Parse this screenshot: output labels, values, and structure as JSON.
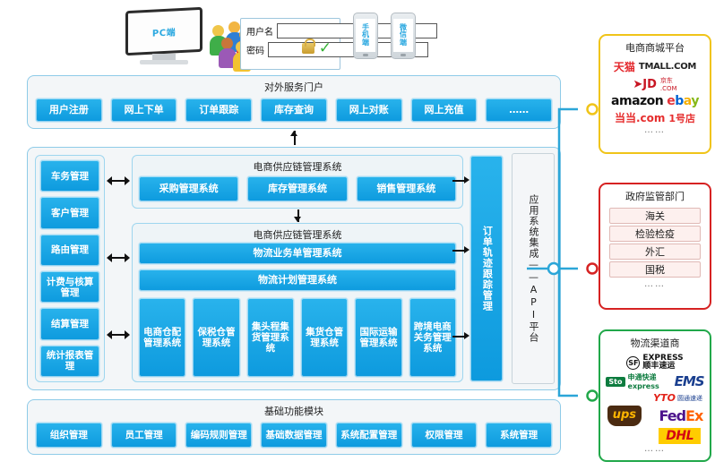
{
  "devices": {
    "pc_label": "PC端",
    "login": {
      "username_label": "用户名",
      "password_label": "密码",
      "username_value": "",
      "password_value": ""
    },
    "mobile_label": "手机端",
    "wechat_label": "微信端"
  },
  "portal": {
    "title": "对外服务门户",
    "buttons": [
      "用户注册",
      "网上下单",
      "订单跟踪",
      "库存查询",
      "网上对账",
      "网上充值",
      "……"
    ]
  },
  "sidebar": {
    "items": [
      "车务管理",
      "客户管理",
      "路由管理",
      "计费与核算管理",
      "结算管理",
      "统计报表管理"
    ]
  },
  "supply_chain_1": {
    "title": "电商供应链管理系统",
    "systems": [
      "采购管理系统",
      "库存管理系统",
      "销售管理系统"
    ]
  },
  "supply_chain_2": {
    "title": "电商供应链管理系统",
    "wide_systems": [
      "物流业务单管理系统",
      "物流计划管理系统"
    ],
    "sub_systems": [
      "电商仓配管理系统",
      "保税仓管理系统",
      "集头程集货管理系统",
      "集货仓管理系统",
      "国际运输管理系统",
      "跨境电商关务管理系统"
    ]
  },
  "order_track": {
    "label": "订单轨迹跟踪管理"
  },
  "api_platform": {
    "label": "应用系统集成——API平台"
  },
  "base_module": {
    "title": "基础功能模块",
    "buttons": [
      "组织管理",
      "员工管理",
      "编码规则管理",
      "基础数据管理",
      "系统配置管理",
      "权限管理",
      "系统管理"
    ]
  },
  "right_panels": {
    "mall": {
      "title": "电商商城平台",
      "border_color": "#f0c419",
      "logos": [
        "天猫 TMALL.COM",
        "JD.COM 京东",
        "amazon",
        "ebay",
        "当当.com",
        "1号店"
      ],
      "more": "……"
    },
    "government": {
      "title": "政府监管部门",
      "border_color": "#d62222",
      "items": [
        "海关",
        "检验检疫",
        "外汇",
        "国税"
      ],
      "more": "……"
    },
    "logistics": {
      "title": "物流渠道商",
      "border_color": "#21a84a",
      "logos": [
        "SF EXPRESS 顺丰速运",
        "EMS",
        "STO express 申通快递",
        "YTO 圆通速递",
        "ups",
        "FedEx",
        "DHL"
      ],
      "more": "……"
    }
  },
  "colors": {
    "button_blue": "#16a6e6",
    "panel_border": "#8ecbe8",
    "connector": "#2ba6d8"
  }
}
